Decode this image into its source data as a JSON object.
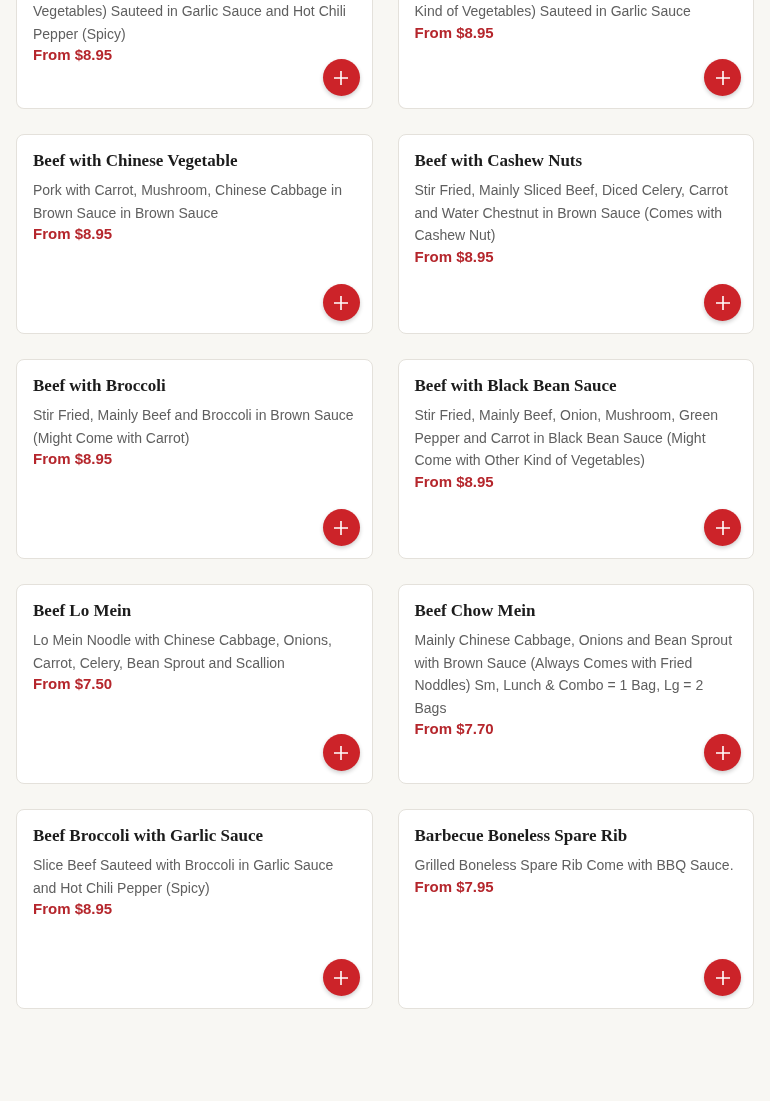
{
  "items": [
    {
      "description": "Vegetables) Sauteed in Garlic Sauce and Hot Chili Pepper (Spicy)",
      "price": "From $8.95",
      "cut": true
    },
    {
      "description": "Kind of Vegetables) Sauteed in Garlic Sauce",
      "price": "From $8.95",
      "cut": true
    },
    {
      "name": "Beef with Chinese Vegetable",
      "description": "Pork with Carrot, Mushroom, Chinese Cabbage in Brown Sauce in Brown Sauce",
      "price": "From $8.95"
    },
    {
      "name": "Beef with Cashew Nuts",
      "description": "Stir Fried, Mainly Sliced Beef, Diced Celery, Carrot and Water Chestnut in Brown Sauce (Comes with Cashew Nut)",
      "price": "From $8.95"
    },
    {
      "name": "Beef with Broccoli",
      "description": "Stir Fried, Mainly Beef and Broccoli in Brown Sauce (Might Come with Carrot)",
      "price": "From $8.95"
    },
    {
      "name": "Beef with Black Bean Sauce",
      "description": "Stir Fried, Mainly Beef, Onion, Mushroom, Green Pepper and Carrot in Black Bean Sauce (Might Come with Other Kind of Vegetables)",
      "price": "From $8.95"
    },
    {
      "name": "Beef Lo Mein",
      "description": "Lo Mein Noodle with Chinese Cabbage, Onions, Carrot, Celery, Bean Sprout and Scallion",
      "price": "From $7.50"
    },
    {
      "name": "Beef Chow Mein",
      "description": "Mainly Chinese Cabbage, Onions and Bean Sprout with Brown Sauce (Always Comes with Fried Noddles) Sm, Lunch & Combo = 1 Bag, Lg = 2 Bags",
      "price": "From $7.70"
    },
    {
      "name": "Beef Broccoli with Garlic Sauce",
      "description": "Slice Beef Sauteed with Broccoli in Garlic Sauce and Hot Chili Pepper (Spicy)",
      "price": "From $8.95"
    },
    {
      "name": "Barbecue Boneless Spare Rib",
      "description": "Grilled Boneless Spare Rib Come with BBQ Sauce.",
      "price": "From $7.95"
    }
  ]
}
